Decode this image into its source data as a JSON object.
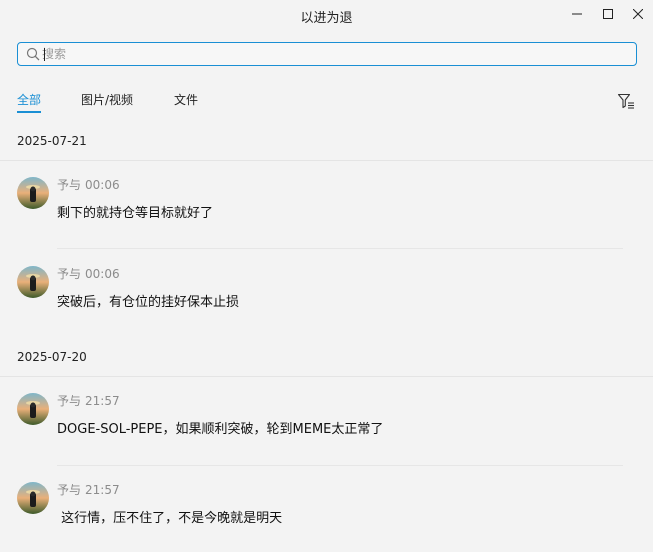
{
  "window": {
    "title": "以进为退",
    "controls": {
      "minimize": "minimize",
      "maximize": "maximize",
      "close": "close"
    }
  },
  "search": {
    "placeholder": "搜索",
    "value": ""
  },
  "tabs": [
    {
      "label": "全部",
      "active": true
    },
    {
      "label": "图片/视频",
      "active": false
    },
    {
      "label": "文件",
      "active": false
    }
  ],
  "groups": [
    {
      "date": "2025-07-21",
      "messages": [
        {
          "sender": "予与",
          "time": "00:06",
          "text": "剩下的就持仓等目标就好了"
        },
        {
          "sender": "予与",
          "time": "00:06",
          "text": "突破后，有仓位的挂好保本止损"
        }
      ]
    },
    {
      "date": "2025-07-20",
      "messages": [
        {
          "sender": "予与",
          "time": "21:57",
          "text": "DOGE-SOL-PEPE，如果顺利突破，轮到MEME太正常了"
        },
        {
          "sender": "予与",
          "time": "21:57",
          "text": " 这行情，压不住了，不是今晚就是明天"
        }
      ]
    }
  ],
  "colors": {
    "accent": "#1a8fd4",
    "background": "#f3f3f3",
    "meta": "#8c8c8c"
  }
}
